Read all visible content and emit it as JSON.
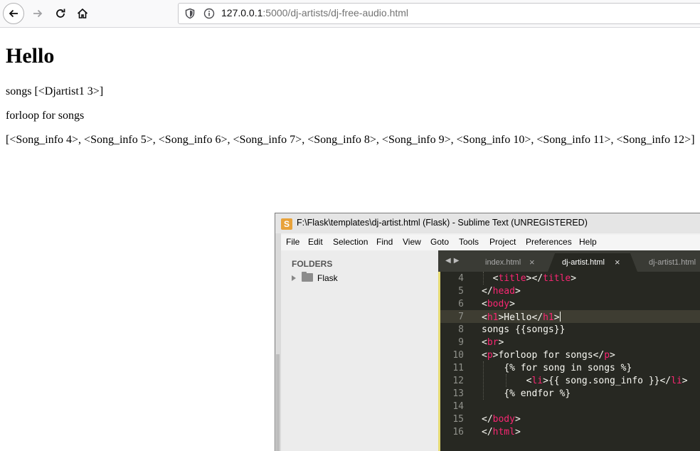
{
  "browser": {
    "url_host": "127.0.0.1",
    "url_rest": ":5000/dj-artists/dj-free-audio.html"
  },
  "page": {
    "heading": "Hello",
    "songs_line": "songs [<Djartist1 3>]",
    "forloop_line": "forloop for songs",
    "list_line": "[<Song_info 4>, <Song_info 5>, <Song_info 6>, <Song_info 7>, <Song_info 8>, <Song_info 9>, <Song_info 10>, <Song_info 11>, <Song_info 12>]"
  },
  "sublime": {
    "title": "F:\\Flask\\templates\\dj-artist.html (Flask) - Sublime Text (UNREGISTERED)",
    "menu": [
      "File",
      "Edit",
      "Selection",
      "Find",
      "View",
      "Goto",
      "Tools",
      "Project",
      "Preferences",
      "Help"
    ],
    "sidebar": {
      "header": "FOLDERS",
      "folder": "Flask"
    },
    "tabs": [
      "index.html",
      "dj-artist.html",
      "dj-artist1.html"
    ],
    "tab_close": "×",
    "line_numbers": [
      "4",
      "5",
      "6",
      "7",
      "8",
      "9",
      "10",
      "11",
      "12",
      "13",
      "14",
      "15",
      "16"
    ],
    "code": {
      "l4_open": "<",
      "l4_tag1": "title",
      "l4_mid": "></",
      "l4_tag2": "title",
      "l4_end": ">",
      "l5_a": "</",
      "l5_tag": "head",
      "l5_b": ">",
      "l6_a": "<",
      "l6_tag": "body",
      "l6_b": ">",
      "l7_a": "<",
      "l7_tag1": "h1",
      "l7_mid": ">Hello</",
      "l7_tag2": "h1",
      "l7_b": ">",
      "l8": "songs {{songs}}",
      "l9_a": "<",
      "l9_tag": "br",
      "l9_b": ">",
      "l10_a": "<",
      "l10_tag1": "p",
      "l10_mid": ">forloop for songs</",
      "l10_tag2": "p",
      "l10_b": ">",
      "l11": "{% for song in songs %}",
      "l12_a": "<",
      "l12_tag1": "li",
      "l12_mid": ">{{ song.song_info }}</",
      "l12_tag2": "li",
      "l12_b": ">",
      "l13": "{% endfor %}",
      "l15_a": "</",
      "l15_tag": "body",
      "l15_b": ">",
      "l16_a": "</",
      "l16_tag": "html",
      "l16_b": ">"
    }
  }
}
